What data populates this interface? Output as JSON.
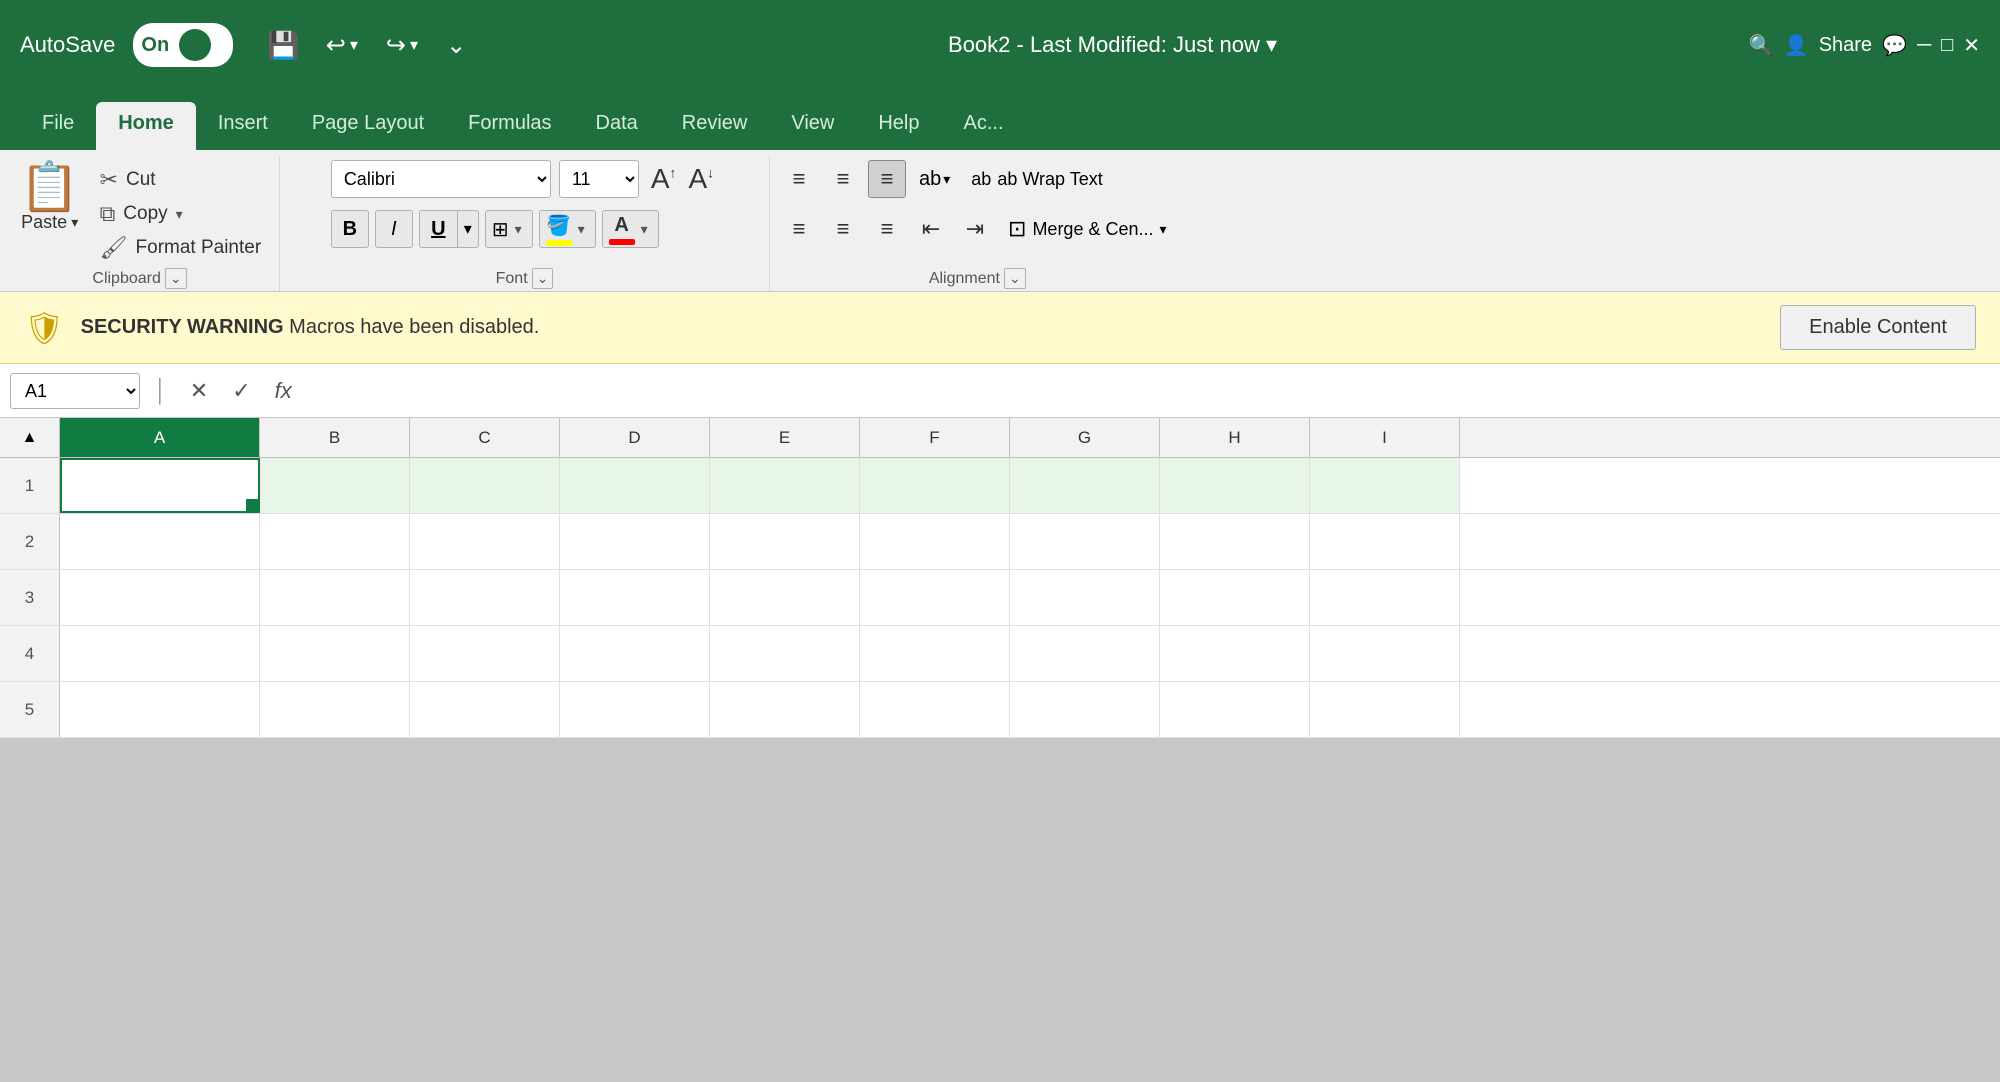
{
  "titlebar": {
    "autosave_label": "AutoSave",
    "toggle_on": "On",
    "title": "Book2 - Last Modified: Just now",
    "title_dropdown_arrow": "▾"
  },
  "tabs": [
    {
      "label": "File",
      "active": false
    },
    {
      "label": "Home",
      "active": true
    },
    {
      "label": "Insert",
      "active": false
    },
    {
      "label": "Page Layout",
      "active": false
    },
    {
      "label": "Formulas",
      "active": false
    },
    {
      "label": "Data",
      "active": false
    },
    {
      "label": "Review",
      "active": false
    },
    {
      "label": "View",
      "active": false
    },
    {
      "label": "Help",
      "active": false
    },
    {
      "label": "Ac...",
      "active": false
    }
  ],
  "clipboard": {
    "paste_label": "Paste",
    "cut_label": "Cut",
    "copy_label": "Copy",
    "format_painter_label": "Format Painter",
    "section_label": "Clipboard",
    "expand_icon": "⌄"
  },
  "font": {
    "font_name": "Calibri",
    "font_size": "11",
    "section_label": "Font",
    "bold_label": "B",
    "italic_label": "I",
    "underline_label": "U",
    "expand_icon": "⌄"
  },
  "alignment": {
    "wrap_text_label": "ab  Wrap Text",
    "merge_label": "Merge & Cen...",
    "section_label": "Alignment",
    "expand_icon": "⌄"
  },
  "security": {
    "icon": "🛡",
    "warning_label": "SECURITY WARNING",
    "message": "Macros have been disabled.",
    "button_label": "Enable Content"
  },
  "formula_bar": {
    "cell_ref": "A1",
    "formula_placeholder": ""
  },
  "grid": {
    "columns": [
      "A",
      "B",
      "C",
      "D",
      "E",
      "F",
      "G",
      "H",
      "I"
    ],
    "rows": [
      "1",
      "2",
      "3",
      "4",
      "5"
    ]
  }
}
